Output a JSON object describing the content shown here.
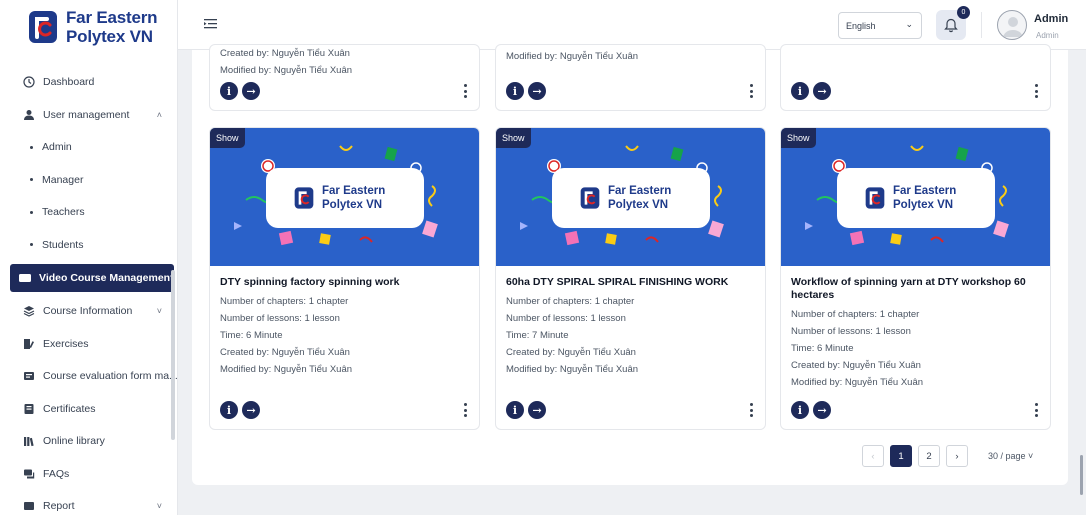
{
  "brand": {
    "line1": "Far Eastern",
    "line2": "Polytex VN",
    "color": "#1e3a8a"
  },
  "sidebar": {
    "items": [
      {
        "label": "Dashboard",
        "icon": "clock-icon"
      },
      {
        "label": "User management",
        "icon": "users-icon",
        "chevron": "˄"
      },
      {
        "label": "Admin",
        "sub": true
      },
      {
        "label": "Manager",
        "sub": true
      },
      {
        "label": "Teachers",
        "sub": true
      },
      {
        "label": "Students",
        "sub": true
      },
      {
        "label": "Video Course Management",
        "icon": "video-icon",
        "active": true
      },
      {
        "label": "Course Information",
        "icon": "layers-icon",
        "chevron": "˅"
      },
      {
        "label": "Exercises",
        "icon": "pencil-icon"
      },
      {
        "label": "Course evaluation form ma...",
        "icon": "form-icon"
      },
      {
        "label": "Certificates",
        "icon": "certificate-icon"
      },
      {
        "label": "Online library",
        "icon": "library-icon"
      },
      {
        "label": "FAQs",
        "icon": "chat-icon"
      },
      {
        "label": "Report",
        "icon": "report-icon",
        "chevron": "˅"
      }
    ]
  },
  "header": {
    "language": "English",
    "notification_count": "0",
    "user_name": "Admin",
    "user_role": "Admin"
  },
  "top_cards": [
    {
      "created": "Created by: Nguyễn Tiểu Xuân",
      "modified": "Modified by: Nguyễn Tiểu Xuân"
    },
    {
      "created": "",
      "modified": "Modified by: Nguyễn Tiểu Xuân"
    },
    {
      "created": "",
      "modified": ""
    }
  ],
  "cards": [
    {
      "badge": "Show",
      "thumb_line1": "Far Eastern",
      "thumb_line2": "Polytex VN",
      "title": "DTY spinning factory spinning work",
      "chapters": "Number of chapters: 1 chapter",
      "lessons": "Number of lessons: 1 lesson",
      "time": "Time: 6 Minute",
      "created": "Created by: Nguyễn Tiểu Xuân",
      "modified": "Modified by: Nguyễn Tiểu Xuân"
    },
    {
      "badge": "Show",
      "thumb_line1": "Far Eastern",
      "thumb_line2": "Polytex VN",
      "title": "60ha DTY SPIRAL SPIRAL FINISHING WORK",
      "chapters": "Number of chapters: 1 chapter",
      "lessons": "Number of lessons: 1 lesson",
      "time": "Time: 7 Minute",
      "created": "Created by: Nguyễn Tiểu Xuân",
      "modified": "Modified by: Nguyễn Tiểu Xuân"
    },
    {
      "badge": "Show",
      "thumb_line1": "Far Eastern",
      "thumb_line2": "Polytex VN",
      "title": "Workflow of spinning yarn at DTY workshop 60 hectares",
      "chapters": "Number of chapters: 1 chapter",
      "lessons": "Number of lessons: 1 lesson",
      "time": "Time: 6 Minute",
      "created": "Created by: Nguyễn Tiểu Xuân",
      "modified": "Modified by: Nguyễn Tiểu Xuân"
    }
  ],
  "actions": {
    "info": "i",
    "go": "→"
  },
  "pagination": {
    "prev": "‹",
    "pages": [
      "1",
      "2"
    ],
    "current": "1",
    "next": "›",
    "per_page": "30 / page ˅"
  },
  "colors": {
    "navy": "#1e2a5a",
    "thumb_blue": "#2a61c9"
  }
}
